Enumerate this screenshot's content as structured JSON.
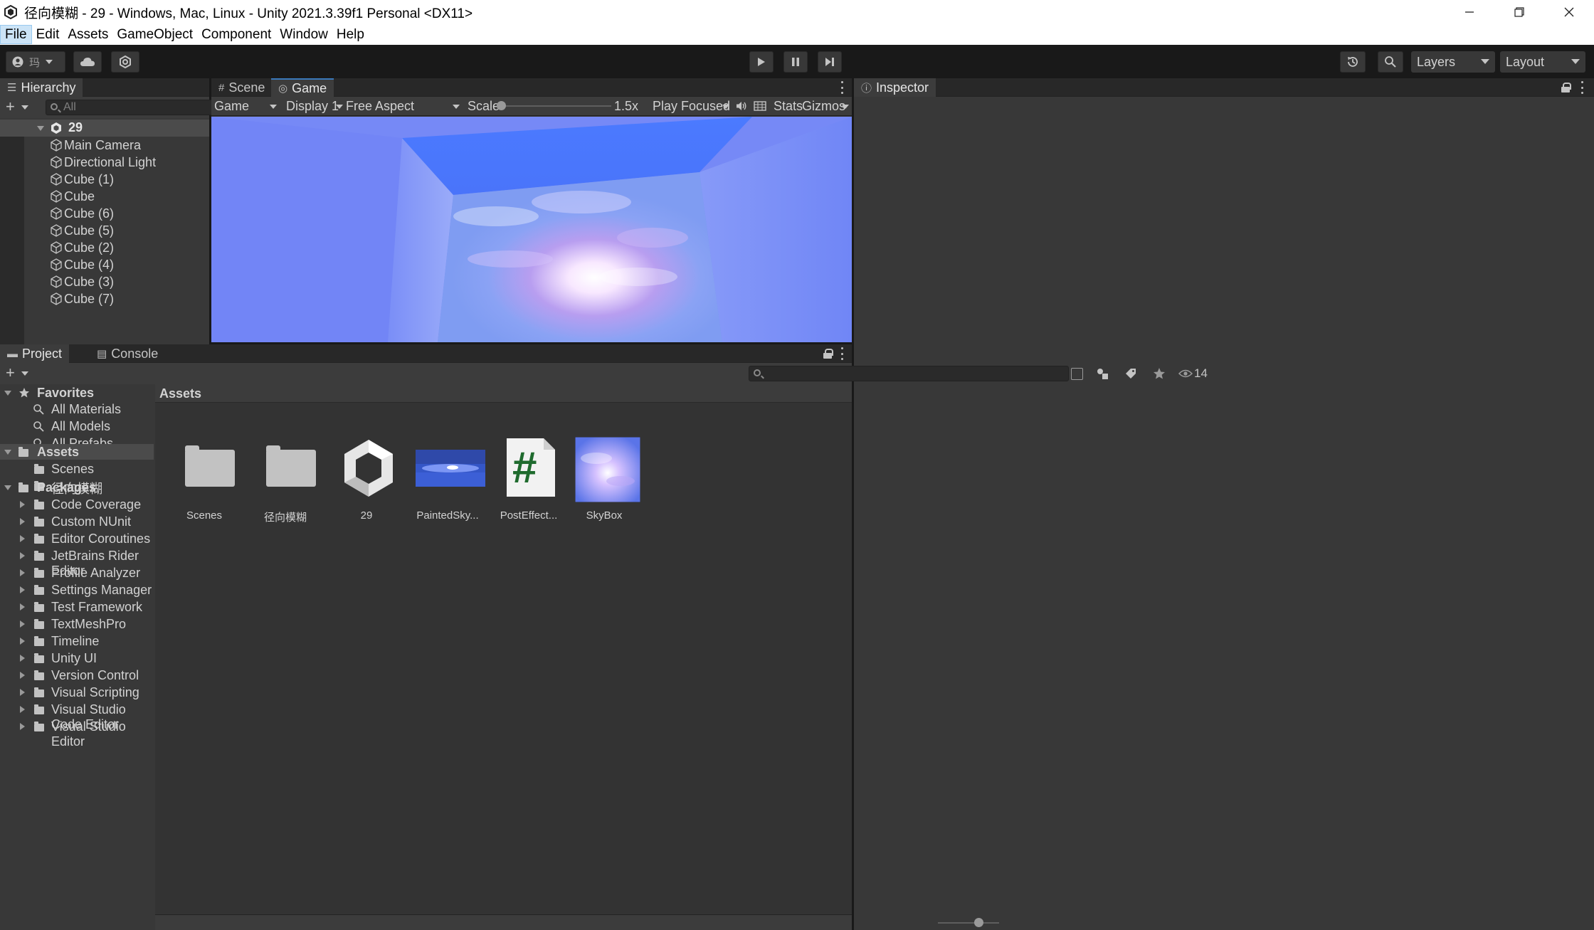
{
  "window": {
    "title": "径向模糊 - 29 - Windows, Mac, Linux - Unity 2021.3.39f1 Personal <DX11>"
  },
  "menu": [
    "File",
    "Edit",
    "Assets",
    "GameObject",
    "Component",
    "Window",
    "Help"
  ],
  "toolbar": {
    "account_label": "玛",
    "layers_label": "Layers",
    "layout_label": "Layout"
  },
  "hierarchy": {
    "tab_label": "Hierarchy",
    "search_placeholder": "All",
    "scene_name": "29",
    "objects": [
      "Main Camera",
      "Directional Light",
      "Cube (1)",
      "Cube",
      "Cube (6)",
      "Cube (5)",
      "Cube (2)",
      "Cube (4)",
      "Cube (3)",
      "Cube (7)"
    ]
  },
  "game": {
    "tabs": [
      "Scene",
      "Game"
    ],
    "view_dropdown": "Game",
    "display_dropdown": "Display 1",
    "aspect_dropdown": "Free Aspect",
    "scale_label": "Scale",
    "scale_value": "1.5x",
    "play_mode_dropdown": "Play Focused",
    "stats_label": "Stats",
    "gizmos_label": "Gizmos"
  },
  "inspector": {
    "tab_label": "Inspector"
  },
  "project": {
    "tabs": [
      "Project",
      "Console"
    ],
    "favorites_label": "Favorites",
    "favorites": [
      "All Materials",
      "All Models",
      "All Prefabs"
    ],
    "assets_label": "Assets",
    "asset_folders": [
      "Scenes",
      "径向模糊"
    ],
    "packages_label": "Packages",
    "packages": [
      "Code Coverage",
      "Custom NUnit",
      "Editor Coroutines",
      "JetBrains Rider Editor",
      "Profile Analyzer",
      "Settings Manager",
      "Test Framework",
      "TextMeshPro",
      "Timeline",
      "Unity UI",
      "Version Control",
      "Visual Scripting",
      "Visual Studio Code Editor",
      "Visual Studio Editor"
    ],
    "breadcrumb": "Assets",
    "hidden_count": "14",
    "assets": [
      {
        "label": "Scenes",
        "icon": "folder-icon"
      },
      {
        "label": "径向模糊",
        "icon": "folder-icon"
      },
      {
        "label": "29",
        "icon": "unity-scene-icon"
      },
      {
        "label": "PaintedSky...",
        "icon": "material-preview"
      },
      {
        "label": "PostEffect...",
        "icon": "csharp-script-icon"
      },
      {
        "label": "SkyBox",
        "icon": "texture-preview"
      }
    ],
    "csharp_glyph": "#"
  },
  "colors": {
    "editor_bg": "#383838",
    "accent": "#3a79bb",
    "sky_blue": "#4b7aff"
  }
}
